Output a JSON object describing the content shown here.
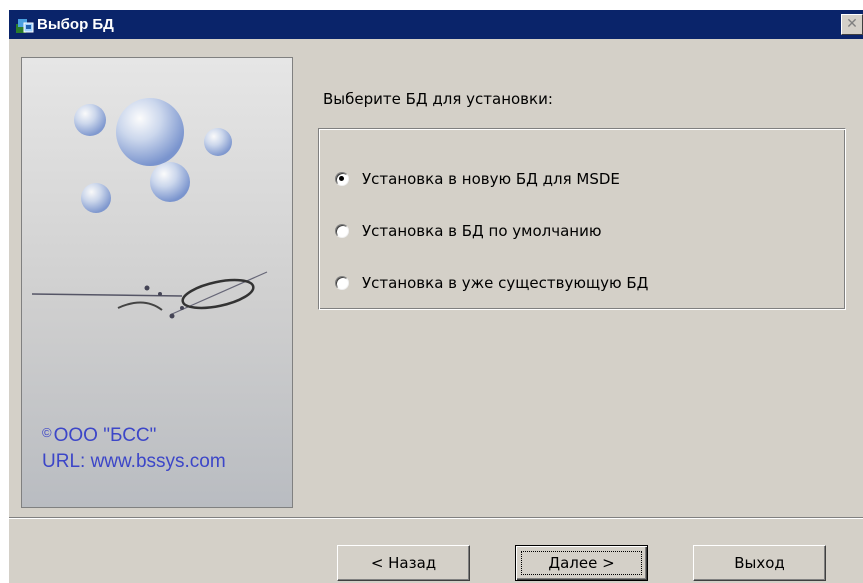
{
  "window": {
    "title": "Выбор БД",
    "close_label": "✕",
    "title_icon": "installer-icon"
  },
  "side_panel": {
    "copyright_symbol": "©",
    "company": "ООО \"БСС\"",
    "url_line": "URL: www.bssys.com",
    "text_color": "#3c46c8",
    "art": "water-drops-and-ring-illustration"
  },
  "main": {
    "prompt": "Выберите БД для установки:",
    "options": [
      {
        "label": "Установка в новую БД для MSDE",
        "checked": true
      },
      {
        "label": "Установка в БД по умолчанию",
        "checked": false
      },
      {
        "label": "Установка в уже существующую БД",
        "checked": false
      }
    ]
  },
  "buttons": {
    "back": "< Назад",
    "next": "Далее >",
    "exit": "Выход"
  },
  "colors": {
    "titlebar": "#0a246a",
    "dialog_bg": "#d4d0c8"
  }
}
